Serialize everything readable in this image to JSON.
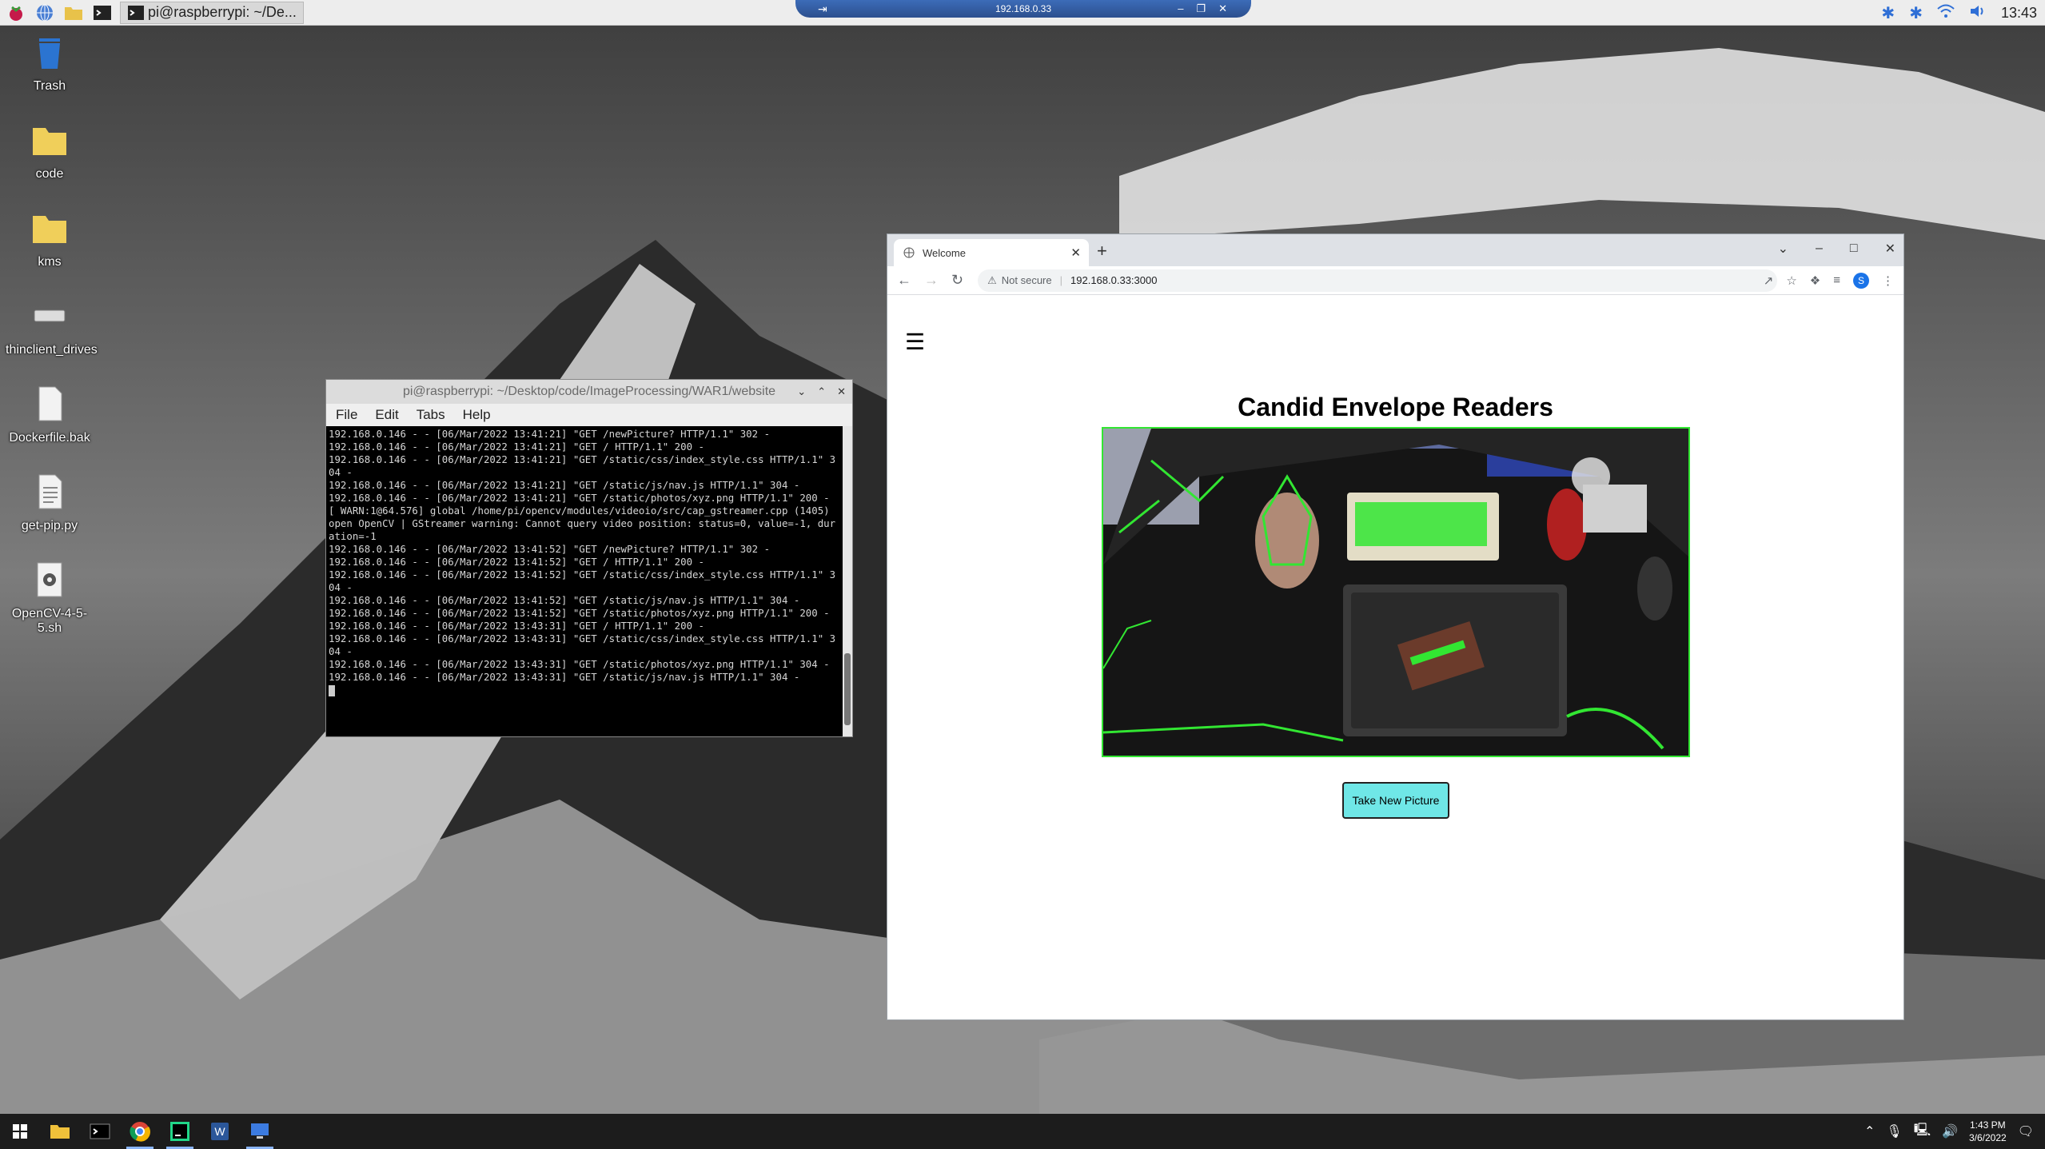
{
  "rpi_panel": {
    "active_task": "pi@raspberrypi: ~/De...",
    "time": "13:43"
  },
  "vnc_bar": {
    "address": "192.168.0.33"
  },
  "desktop_icons": [
    {
      "label": "Trash"
    },
    {
      "label": "code"
    },
    {
      "label": "kms"
    },
    {
      "label": "thinclient_drives"
    },
    {
      "label": "Dockerfile.bak"
    },
    {
      "label": "get-pip.py"
    },
    {
      "label": "OpenCV-4-5-5.sh"
    }
  ],
  "terminal": {
    "title": "pi@raspberrypi: ~/Desktop/code/ImageProcessing/WAR1/website",
    "menu": [
      "File",
      "Edit",
      "Tabs",
      "Help"
    ],
    "log": "192.168.0.146 - - [06/Mar/2022 13:41:21] \"GET /newPicture? HTTP/1.1\" 302 -\n192.168.0.146 - - [06/Mar/2022 13:41:21] \"GET / HTTP/1.1\" 200 -\n192.168.0.146 - - [06/Mar/2022 13:41:21] \"GET /static/css/index_style.css HTTP/1.1\" 304 -\n192.168.0.146 - - [06/Mar/2022 13:41:21] \"GET /static/js/nav.js HTTP/1.1\" 304 -\n192.168.0.146 - - [06/Mar/2022 13:41:21] \"GET /static/photos/xyz.png HTTP/1.1\" 200 -\n[ WARN:1@64.576] global /home/pi/opencv/modules/videoio/src/cap_gstreamer.cpp (1405) open OpenCV | GStreamer warning: Cannot query video position: status=0, value=-1, duration=-1\n192.168.0.146 - - [06/Mar/2022 13:41:52] \"GET /newPicture? HTTP/1.1\" 302 -\n192.168.0.146 - - [06/Mar/2022 13:41:52] \"GET / HTTP/1.1\" 200 -\n192.168.0.146 - - [06/Mar/2022 13:41:52] \"GET /static/css/index_style.css HTTP/1.1\" 304 -\n192.168.0.146 - - [06/Mar/2022 13:41:52] \"GET /static/js/nav.js HTTP/1.1\" 304 -\n192.168.0.146 - - [06/Mar/2022 13:41:52] \"GET /static/photos/xyz.png HTTP/1.1\" 200 -\n192.168.0.146 - - [06/Mar/2022 13:43:31] \"GET / HTTP/1.1\" 200 -\n192.168.0.146 - - [06/Mar/2022 13:43:31] \"GET /static/css/index_style.css HTTP/1.1\" 304 -\n192.168.0.146 - - [06/Mar/2022 13:43:31] \"GET /static/photos/xyz.png HTTP/1.1\" 304 -\n192.168.0.146 - - [06/Mar/2022 13:43:31] \"GET /static/js/nav.js HTTP/1.1\" 304 -\n"
  },
  "browser": {
    "tab_title": "Welcome",
    "security_label": "Not secure",
    "url": "192.168.0.33:3000",
    "avatar_letter": "S",
    "page": {
      "title": "Candid Envelope Readers",
      "button": "Take New Picture",
      "menu_glyph": "☰"
    }
  },
  "win_taskbar": {
    "time": "1:43 PM",
    "date": "3/6/2022"
  },
  "colors": {
    "button_bg": "#6fe7e7",
    "photo_border": "#32e632",
    "vnc_bar": "#2c4f8e"
  }
}
